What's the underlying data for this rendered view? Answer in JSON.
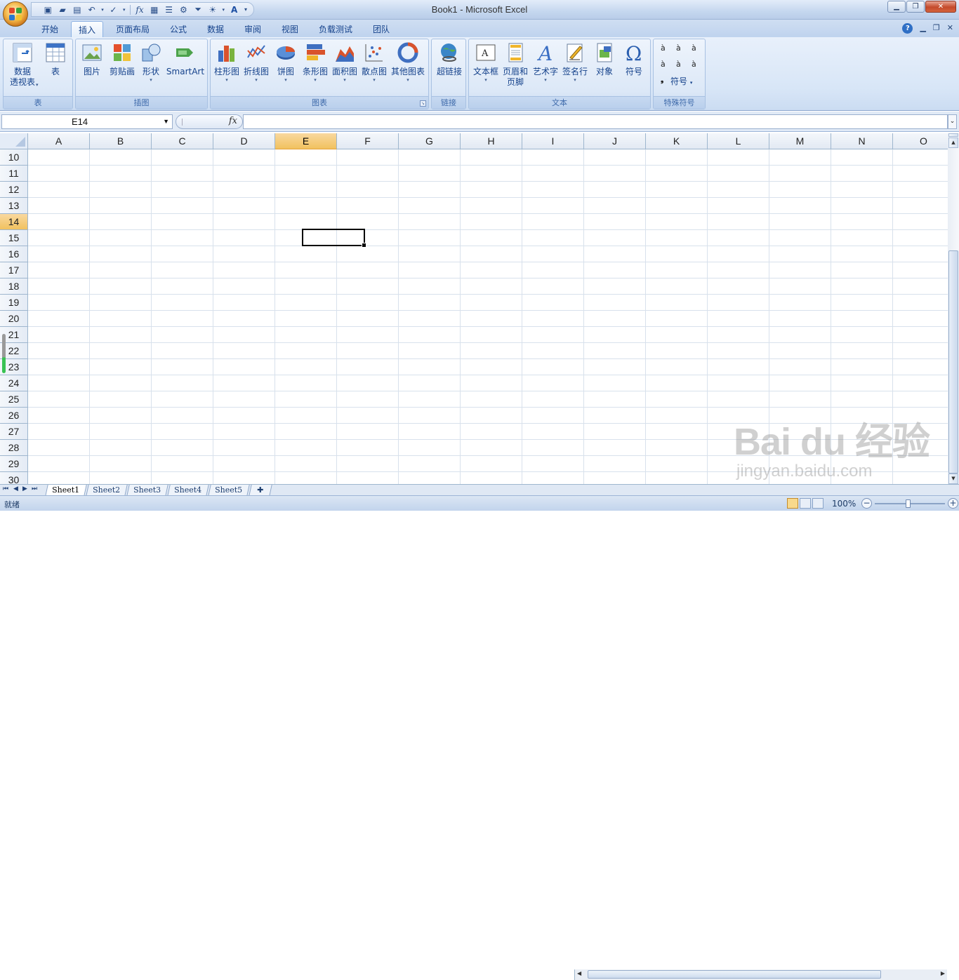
{
  "window": {
    "title": "Book1 - Microsoft Excel"
  },
  "quick_access": {
    "icons": [
      "save-icon",
      "open-icon",
      "print-preview-icon",
      "undo-icon",
      "check-icon",
      "function-icon",
      "grid-icon",
      "form-icon",
      "network-icon",
      "filter-icon",
      "picture-icon",
      "text-a-icon"
    ]
  },
  "tabs": [
    "开始",
    "插入",
    "页面布局",
    "公式",
    "数据",
    "审阅",
    "视图",
    "负载测试",
    "团队"
  ],
  "active_tab": "插入",
  "ribbon": {
    "groups": {
      "table": "表",
      "illustrations": "插图",
      "charts": "图表",
      "links": "链接",
      "text": "文本",
      "symbols": "特殊符号"
    },
    "buttons": {
      "pivot": "数据",
      "pivot2": "透视表",
      "table": "表",
      "picture": "图片",
      "clipart": "剪贴画",
      "shapes": "形状",
      "smartart": "SmartArt",
      "column": "柱形图",
      "line": "折线图",
      "pie": "饼图",
      "bar": "条形图",
      "area": "面积图",
      "scatter": "散点图",
      "other": "其他图表",
      "hyperlink": "超链接",
      "textbox": "文本框",
      "header": "页眉和",
      "header2": "页脚",
      "wordart": "艺术字",
      "signature": "签名行",
      "object": "对象",
      "symbol": "符号",
      "symbol_dd": "符号"
    },
    "symbol_chars": [
      "à",
      "à",
      "à",
      "à",
      "à",
      "à",
      "❟"
    ]
  },
  "formula_bar": {
    "name_box": "E14",
    "fx": "fx",
    "formula": ""
  },
  "columns": [
    "A",
    "B",
    "C",
    "D",
    "E",
    "F",
    "G",
    "H",
    "I",
    "J",
    "K",
    "L",
    "M",
    "N",
    "O"
  ],
  "selected_column": "E",
  "rows": [
    "10",
    "11",
    "12",
    "13",
    "14",
    "15",
    "16",
    "17",
    "18",
    "19",
    "20",
    "21",
    "22",
    "23",
    "24",
    "25",
    "26",
    "27",
    "28",
    "29",
    "30"
  ],
  "selected_row": "14",
  "sheets": [
    "Sheet1",
    "Sheet2",
    "Sheet3",
    "Sheet4",
    "Sheet5"
  ],
  "active_sheet": "Sheet1",
  "status": {
    "text": "就绪",
    "zoom": "100%"
  },
  "watermark": {
    "logo": "Bai du 经验",
    "url": "jingyan.baidu.com"
  }
}
